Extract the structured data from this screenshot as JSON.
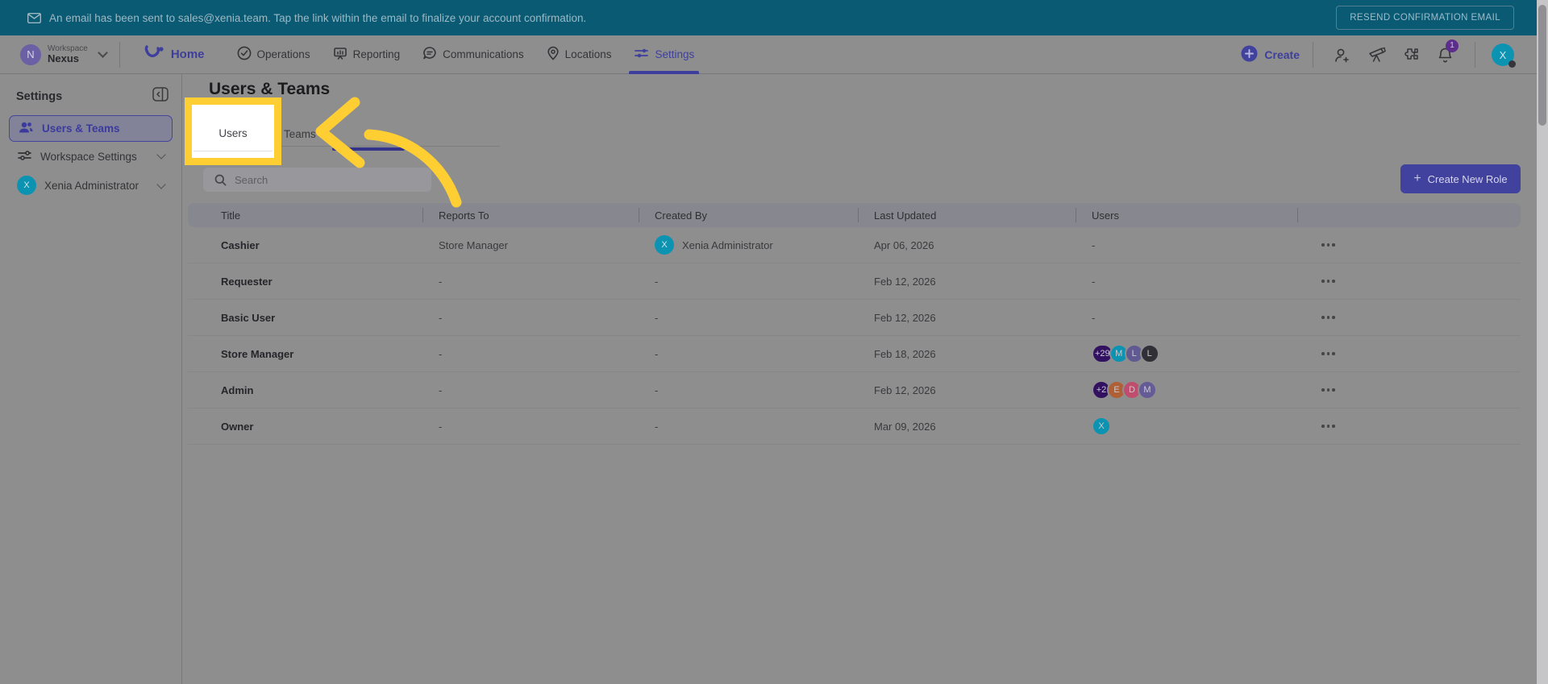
{
  "banner": {
    "message": "An email has been sent to sales@xenia.team. Tap the link within the email to finalize your account confirmation.",
    "resend_label": "RESEND CONFIRMATION EMAIL"
  },
  "nav": {
    "workspace": {
      "eyebrow": "Workspace",
      "name": "Nexus",
      "avatar_letter": "N"
    },
    "items": [
      {
        "label": "Home",
        "icon": "xenia-logo-icon",
        "active": true
      },
      {
        "label": "Operations",
        "icon": "check-circle-icon",
        "active": false
      },
      {
        "label": "Reporting",
        "icon": "presentation-icon",
        "active": false
      },
      {
        "label": "Communications",
        "icon": "chat-bubble-icon",
        "active": false
      },
      {
        "label": "Locations",
        "icon": "map-pin-icon",
        "active": false
      },
      {
        "label": "Settings",
        "icon": "sliders-icon",
        "active": true
      }
    ],
    "create_label": "Create",
    "notification_count": "1",
    "user_avatar_letter": "X"
  },
  "sidebar": {
    "header": "Settings",
    "items": [
      {
        "label": "Users & Teams",
        "icon": "users-icon",
        "selected": true
      },
      {
        "label": "Workspace Settings",
        "icon": "sliders-icon",
        "selected": false
      },
      {
        "label": "Xenia Administrator",
        "icon": "avatar-x",
        "avatar_letter": "X",
        "selected": false
      }
    ]
  },
  "main": {
    "title": "Users & Teams",
    "tabs": [
      {
        "label": "Users",
        "active": true,
        "spotlighted": true
      },
      {
        "label": "Teams",
        "active": false
      }
    ],
    "search_placeholder": "Search",
    "create_role_label": "Create New Role",
    "create_role_plus": "+"
  },
  "table": {
    "columns": [
      "Title",
      "Reports To",
      "Created By",
      "Last Updated",
      "Users"
    ],
    "rows": [
      {
        "title": "Cashier",
        "reports_to": "Store Manager",
        "created_by": "Xenia Administrator",
        "created_by_avatar": "X",
        "last_updated": "Apr 06, 2026",
        "users": "-",
        "users_avatars": []
      },
      {
        "title": "Requester",
        "reports_to": "-",
        "created_by": "-",
        "created_by_avatar": "",
        "last_updated": "Feb 12, 2026",
        "users": "-",
        "users_avatars": []
      },
      {
        "title": "Basic User",
        "reports_to": "-",
        "created_by": "-",
        "created_by_avatar": "",
        "last_updated": "Feb 12, 2026",
        "users": "-",
        "users_avatars": []
      },
      {
        "title": "Store Manager",
        "reports_to": "-",
        "created_by": "-",
        "created_by_avatar": "",
        "last_updated": "Feb 18, 2026",
        "users": "",
        "users_avatars": [
          {
            "label": "+29",
            "bg": "#321260"
          },
          {
            "label": "M",
            "bg": "#0d93b2"
          },
          {
            "label": "L",
            "bg": "#615a92"
          },
          {
            "label": "L",
            "bg": "#303036"
          }
        ]
      },
      {
        "title": "Admin",
        "reports_to": "-",
        "created_by": "-",
        "created_by_avatar": "",
        "last_updated": "Feb 12, 2026",
        "users": "",
        "users_avatars": [
          {
            "label": "+2",
            "bg": "#321260"
          },
          {
            "label": "E",
            "bg": "#b06036"
          },
          {
            "label": "D",
            "bg": "#bf4e6e"
          },
          {
            "label": "M",
            "bg": "#655c97"
          }
        ]
      },
      {
        "title": "Owner",
        "reports_to": "-",
        "created_by": "-",
        "created_by_avatar": "",
        "last_updated": "Mar 09, 2026",
        "users": "",
        "users_avatars": [
          {
            "label": "X",
            "bg": "#0d93b2"
          }
        ]
      }
    ]
  },
  "colors": {
    "banner_bg": "#0a5a74",
    "dimmed_page_bg": "#8e8e8e",
    "accent_purple": "#3e3f9d",
    "spotlight_yellow": "#ffce33",
    "avatar_teal": "#0d93b2",
    "notification_badge": "#5c2d8a",
    "create_role_button": "#41419e"
  }
}
